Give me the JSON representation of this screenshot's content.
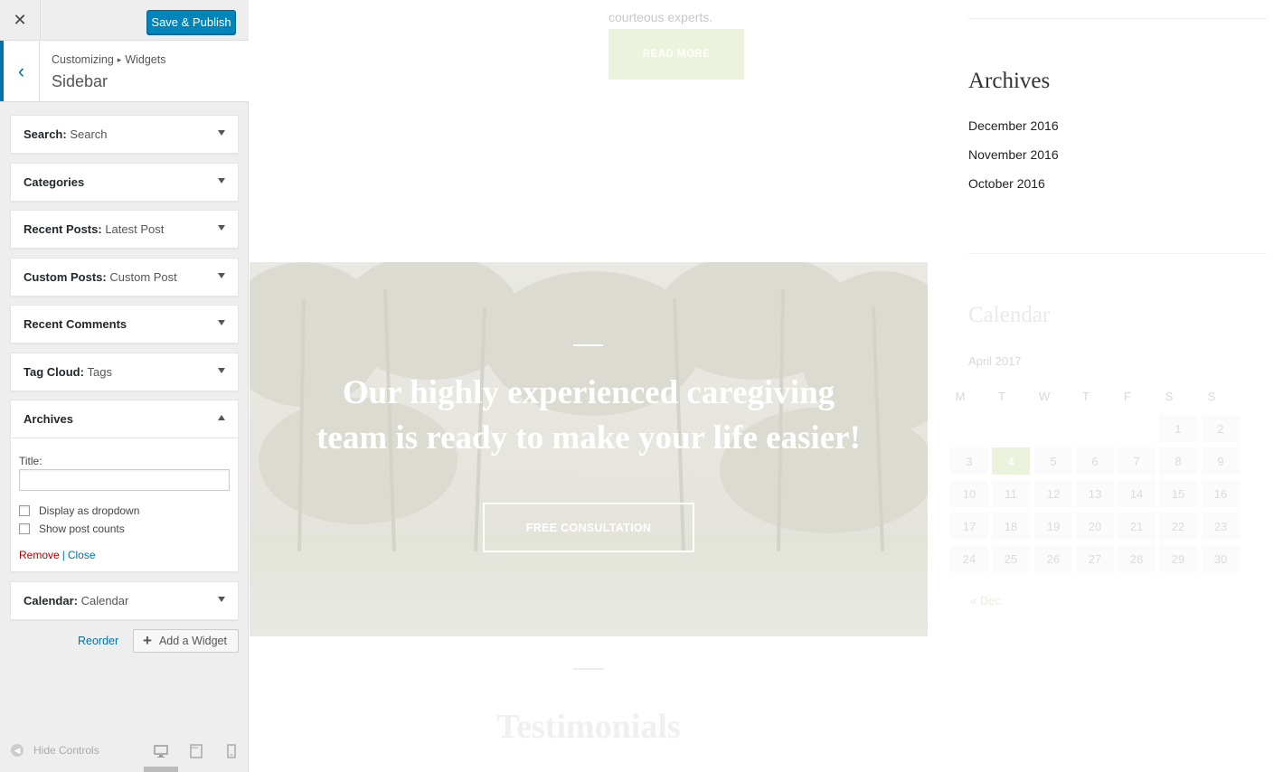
{
  "customizer": {
    "close_icon": "close-icon",
    "save_label": "Save & Publish",
    "breadcrumb": {
      "root": "Customizing",
      "separator": "▸",
      "current": "Widgets"
    },
    "section_title": "Sidebar",
    "widgets": [
      {
        "name": "Search:",
        "sub": "Search"
      },
      {
        "name": "Categories",
        "sub": ""
      },
      {
        "name": "Recent Posts:",
        "sub": "Latest Post"
      },
      {
        "name": "Custom Posts:",
        "sub": "Custom Post"
      },
      {
        "name": "Recent Comments",
        "sub": ""
      },
      {
        "name": "Tag Cloud:",
        "sub": "Tags"
      },
      {
        "name": "Archives",
        "sub": ""
      },
      {
        "name": "Calendar:",
        "sub": "Calendar"
      }
    ],
    "archives_form": {
      "title_label": "Title:",
      "title_value": "",
      "dropdown_label": "Display as dropdown",
      "dropdown_checked": false,
      "counts_label": "Show post counts",
      "counts_checked": false,
      "remove_label": "Remove",
      "separator": "|",
      "close_label": "Close"
    },
    "reorder_label": "Reorder",
    "add_widget_label": "Add a Widget",
    "hide_controls_label": "Hide Controls",
    "accent": "#0073aa",
    "button_color": "#0085ba"
  },
  "preview": {
    "top_text": "courteous experts.",
    "read_more": "READ MORE",
    "archives_title": "Archives",
    "archive_links": [
      "December 2016",
      "November 2016",
      "October 2016"
    ],
    "hero_heading_line1": "Our highly experienced caregiving",
    "hero_heading_line2": "team is ready to make your life easier!",
    "hero_button": "FREE CONSULTATION",
    "testimonials_title": "Testimonials",
    "calendar": {
      "title": "Calendar",
      "month": "April 2017",
      "weekdays": [
        "M",
        "T",
        "W",
        "T",
        "F",
        "S",
        "S"
      ],
      "weeks": [
        [
          "",
          "",
          "",
          "",
          "",
          "1",
          "2"
        ],
        [
          "3",
          "4",
          "5",
          "6",
          "7",
          "8",
          "9"
        ],
        [
          "10",
          "11",
          "12",
          "13",
          "14",
          "15",
          "16"
        ],
        [
          "17",
          "18",
          "19",
          "20",
          "21",
          "22",
          "23"
        ],
        [
          "24",
          "25",
          "26",
          "27",
          "28",
          "29",
          "30"
        ]
      ],
      "today": "4",
      "prev_link": "« Dec"
    },
    "accent_green": "#ebf3dc"
  }
}
